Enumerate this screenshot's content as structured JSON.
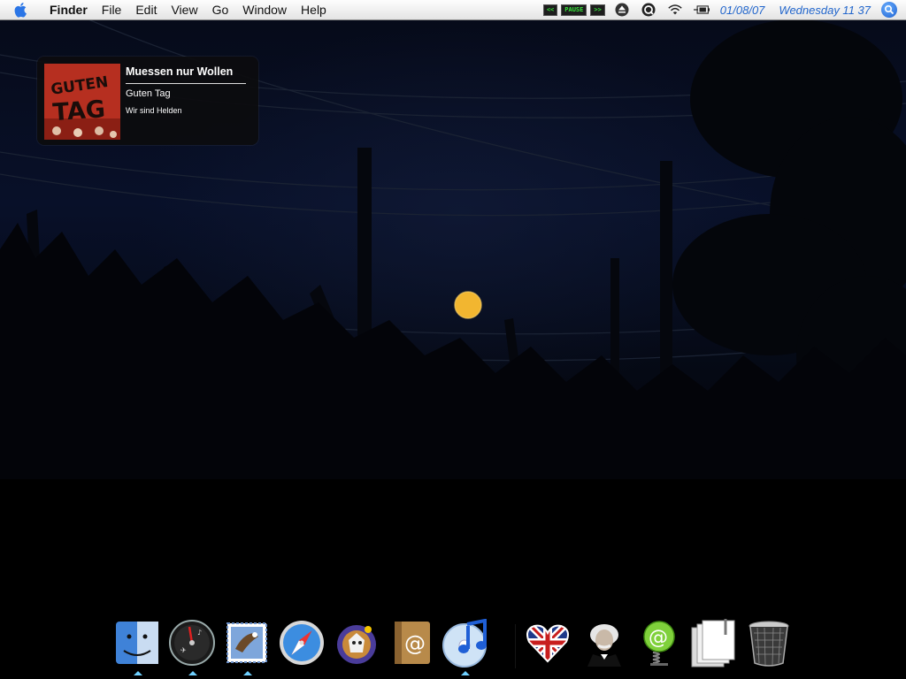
{
  "menubar": {
    "app_name": "Finder",
    "menus": [
      "File",
      "Edit",
      "View",
      "Go",
      "Window",
      "Help"
    ],
    "media_controls": {
      "prev_label": "<<",
      "pause_label": "PAUSE",
      "next_label": ">>"
    },
    "date": "01/08/07",
    "day_time": "Wednesday 11 37",
    "accent_color": "#2266cc"
  },
  "now_playing": {
    "title": "Muessen nur Wollen",
    "album": "Guten Tag",
    "artist": "Wir sind Helden",
    "art_text_line1": "GUTEN",
    "art_text_line2": "TAG"
  },
  "dock": {
    "items": [
      {
        "name": "Finder",
        "icon": "finder-icon",
        "running": true
      },
      {
        "name": "Dashboard",
        "icon": "dashboard-icon",
        "running": true
      },
      {
        "name": "Mail",
        "icon": "mail-icon",
        "running": true
      },
      {
        "name": "Safari",
        "icon": "safari-icon",
        "running": false
      },
      {
        "name": "Adium",
        "icon": "adium-icon",
        "running": false
      },
      {
        "name": "Address Book",
        "icon": "address-book-icon",
        "running": false
      },
      {
        "name": "iTunes",
        "icon": "itunes-icon",
        "running": true
      },
      {
        "name": "Dictionary UK",
        "icon": "uk-heart-icon",
        "running": false
      },
      {
        "name": "Einstein",
        "icon": "einstein-icon",
        "running": false
      },
      {
        "name": "Mail Spring",
        "icon": "at-spring-icon",
        "running": false
      },
      {
        "name": "Documents",
        "icon": "documents-stack-icon",
        "running": false
      },
      {
        "name": "Trash",
        "icon": "trash-icon",
        "running": false
      }
    ]
  }
}
